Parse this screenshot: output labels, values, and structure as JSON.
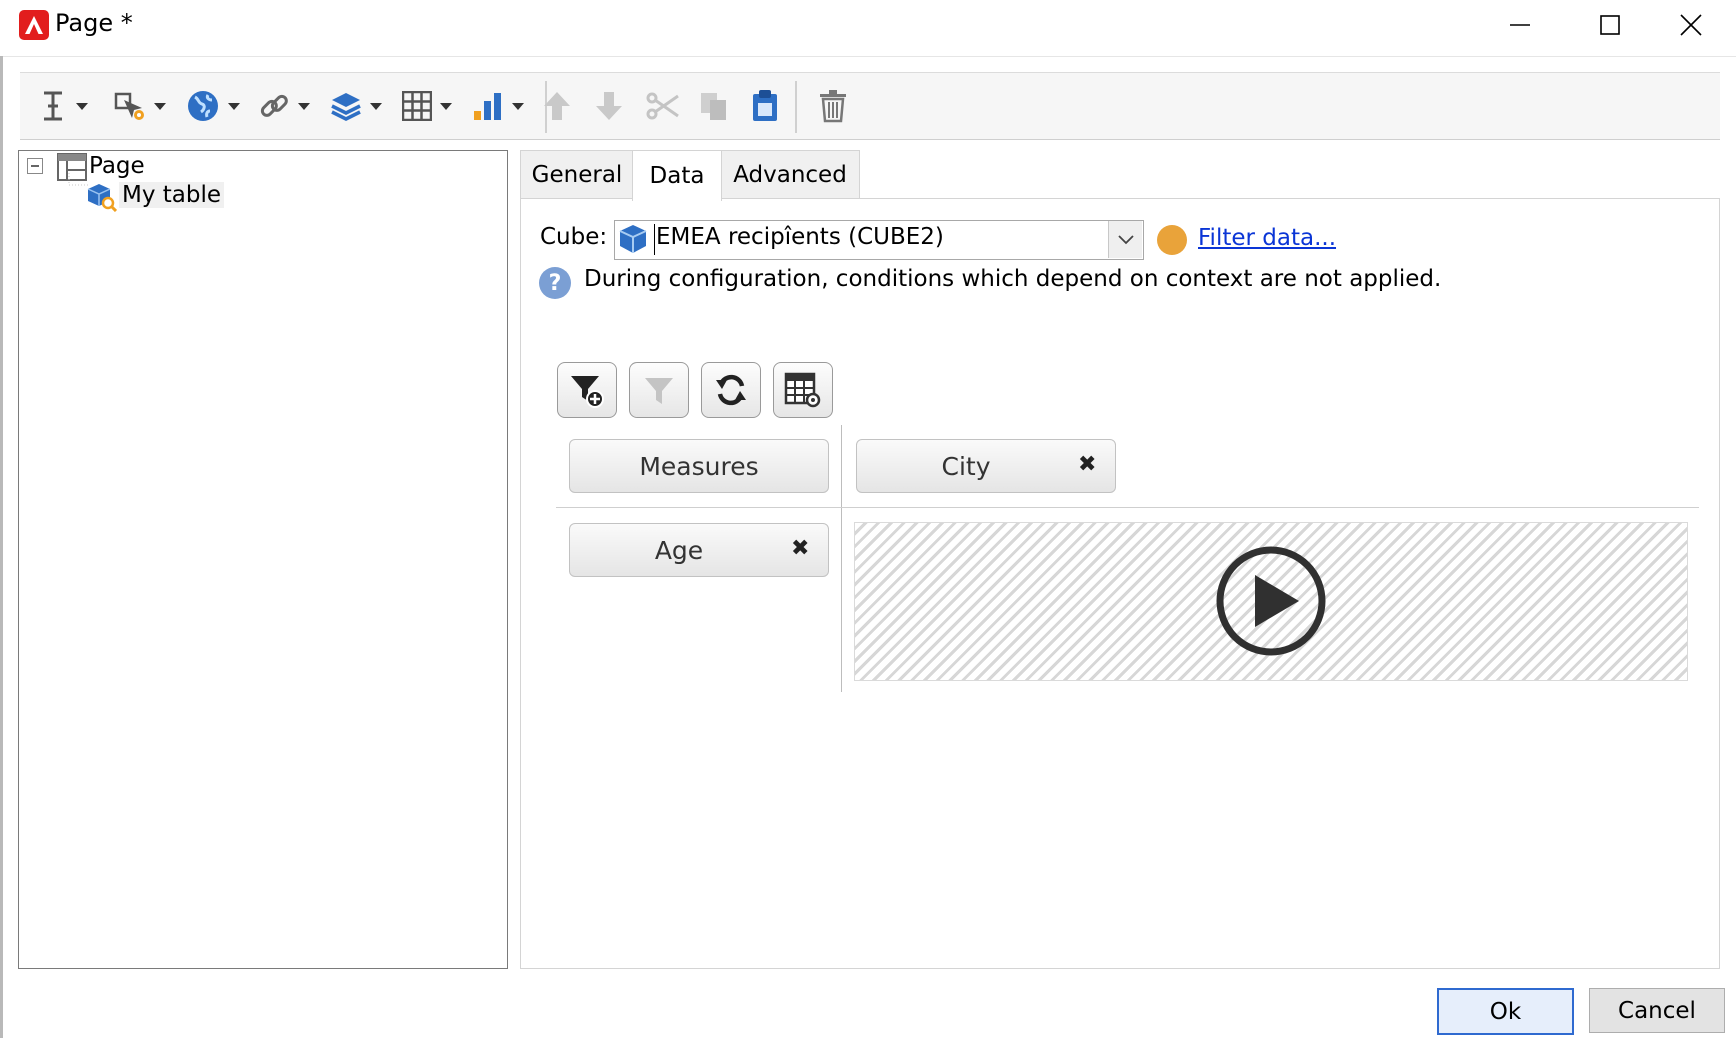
{
  "window": {
    "title": "Page *",
    "minimize": "minimize",
    "maximize": "maximize",
    "close": "close"
  },
  "toolbar": {
    "items": [
      {
        "icon": "text-cursor-icon",
        "dropdown": true
      },
      {
        "icon": "select-gear-icon",
        "dropdown": true
      },
      {
        "icon": "globe-icon",
        "dropdown": true
      },
      {
        "icon": "link-icon",
        "dropdown": true
      },
      {
        "icon": "stack-icon",
        "dropdown": true
      },
      {
        "icon": "grid-icon",
        "dropdown": true
      },
      {
        "icon": "bar-chart-icon",
        "dropdown": true
      },
      {
        "icon": "move-up-icon",
        "enabled": false
      },
      {
        "icon": "move-down-icon",
        "enabled": false
      },
      {
        "icon": "cut-icon",
        "enabled": false
      },
      {
        "icon": "copy-icon",
        "enabled": false
      },
      {
        "icon": "paste-icon",
        "enabled": true
      },
      {
        "icon": "delete-icon",
        "enabled": true
      }
    ]
  },
  "tree": {
    "root": {
      "label": "Page",
      "expanded": true
    },
    "child": {
      "label": "My table",
      "selected": true
    }
  },
  "tabs": [
    {
      "label": "General"
    },
    {
      "label": "Data",
      "active": true
    },
    {
      "label": "Advanced"
    }
  ],
  "data_tab": {
    "cube_label": "Cube:",
    "cube_value": "EMEA recipîents (CUBE2)",
    "status_color": "#e9a33a",
    "filter_link": "Filter data...",
    "info_text": "During configuration, conditions which depend on context are not applied.",
    "pivot": {
      "actions": [
        "add-filter-icon",
        "filter-icon",
        "refresh-icon",
        "table-settings-icon"
      ],
      "measures_label": "Measures",
      "column_dimension": "City",
      "row_dimension": "Age",
      "remove_symbol": "✖"
    }
  },
  "buttons": {
    "ok": "Ok",
    "cancel": "Cancel"
  },
  "colors": {
    "accent": "#2f6ad0",
    "link": "#0a35d6",
    "app_icon": "#e21d1d"
  }
}
